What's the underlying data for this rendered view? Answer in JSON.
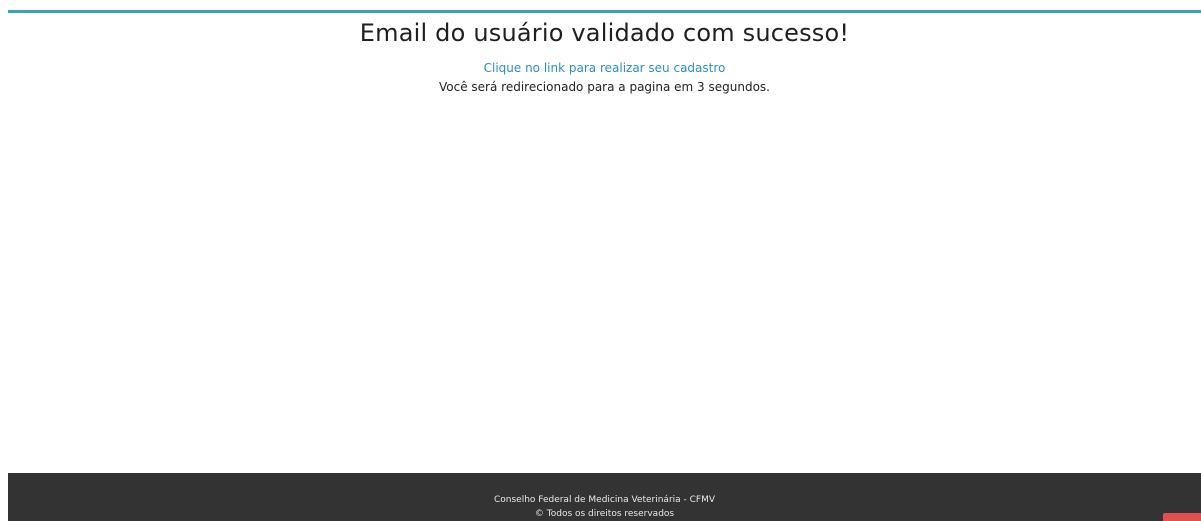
{
  "colors": {
    "accent_bar": "#3aa3b5",
    "link": "#2a8fc0",
    "footer_bg": "#333333",
    "corner_badge": "#e05050"
  },
  "main": {
    "title": "Email do usuário validado com sucesso!",
    "register_link": "Clique no link para realizar seu cadastro",
    "redirect_message": "Você será redirecionado para a pagina em 3 segundos."
  },
  "footer": {
    "organization": "Conselho Federal de Medicina Veterinária - CFMV",
    "copyright": "© Todos os direitos reservados"
  }
}
